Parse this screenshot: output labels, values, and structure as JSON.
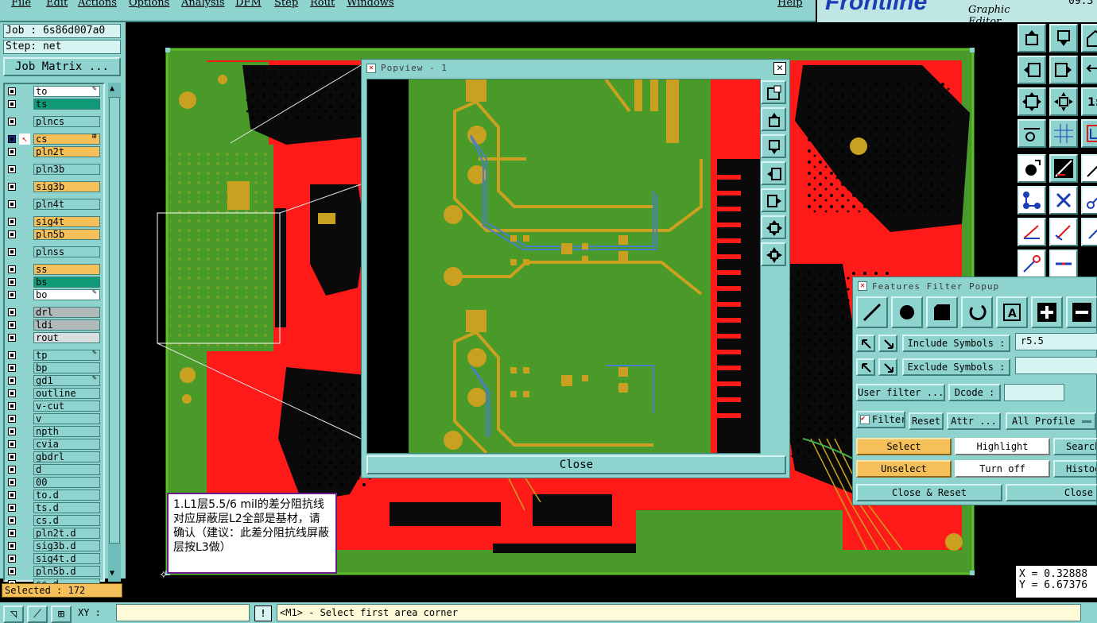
{
  "menubar": {
    "items": [
      "File",
      "Edit",
      "Actions",
      "Options",
      "Analysis",
      "DFM",
      "Step",
      "Rout",
      "Windows"
    ],
    "help": "Help"
  },
  "logo": {
    "brand": "Frontline",
    "subtitle": "Graphic Editor",
    "version": "09.3"
  },
  "job": {
    "label": "Job : 6s86d007a0",
    "step": "Step: net",
    "matrix_button": "Job Matrix ..."
  },
  "layers": [
    {
      "name": "to",
      "color": "#ffffff",
      "tag": "✎"
    },
    {
      "name": "ts",
      "color": "#0f9a78",
      "tag": ""
    },
    {
      "name": "plncs",
      "color": "#8fd3cf",
      "tag": ""
    },
    {
      "name": "cs",
      "color": "#f5c05a",
      "tag": "⊞",
      "active": true
    },
    {
      "name": "pln2t",
      "color": "#f5c05a",
      "tag": ""
    },
    {
      "name": "pln3b",
      "color": "#8fd3cf",
      "tag": ""
    },
    {
      "name": "sig3b",
      "color": "#f5c05a",
      "tag": ""
    },
    {
      "name": "pln4t",
      "color": "#8fd3cf",
      "tag": ""
    },
    {
      "name": "sig4t",
      "color": "#f5c05a",
      "tag": ""
    },
    {
      "name": "pln5b",
      "color": "#f5c05a",
      "tag": ""
    },
    {
      "name": "plnss",
      "color": "#8fd3cf",
      "tag": ""
    },
    {
      "name": "ss",
      "color": "#f5c05a",
      "tag": ""
    },
    {
      "name": "bs",
      "color": "#0f9a78",
      "tag": ""
    },
    {
      "name": "bo",
      "color": "#ffffff",
      "tag": "✎"
    },
    {
      "name": "drl",
      "color": "#aeb9b8",
      "tag": ""
    },
    {
      "name": "ldi",
      "color": "#aeb9b8",
      "tag": ""
    },
    {
      "name": "rout",
      "color": "#d9dede",
      "tag": ""
    },
    {
      "name": "tp",
      "color": "#8fd3cf",
      "tag": "✎"
    },
    {
      "name": "bp",
      "color": "#8fd3cf",
      "tag": ""
    },
    {
      "name": "gd1",
      "color": "#8fd3cf",
      "tag": "✎"
    },
    {
      "name": "outline",
      "color": "#8fd3cf",
      "tag": ""
    },
    {
      "name": "v-cut",
      "color": "#8fd3cf",
      "tag": ""
    },
    {
      "name": "v",
      "color": "#8fd3cf",
      "tag": ""
    },
    {
      "name": "npth",
      "color": "#8fd3cf",
      "tag": ""
    },
    {
      "name": "cvia",
      "color": "#8fd3cf",
      "tag": ""
    },
    {
      "name": "gbdrl",
      "color": "#8fd3cf",
      "tag": ""
    },
    {
      "name": "d",
      "color": "#8fd3cf",
      "tag": ""
    },
    {
      "name": "00",
      "color": "#8fd3cf",
      "tag": ""
    },
    {
      "name": "to.d",
      "color": "#8fd3cf",
      "tag": ""
    },
    {
      "name": "ts.d",
      "color": "#8fd3cf",
      "tag": ""
    },
    {
      "name": "cs.d",
      "color": "#8fd3cf",
      "tag": ""
    },
    {
      "name": "pln2t.d",
      "color": "#8fd3cf",
      "tag": ""
    },
    {
      "name": "sig3b.d",
      "color": "#8fd3cf",
      "tag": ""
    },
    {
      "name": "sig4t.d",
      "color": "#8fd3cf",
      "tag": ""
    },
    {
      "name": "pln5b.d",
      "color": "#8fd3cf",
      "tag": ""
    },
    {
      "name": "ss.d",
      "color": "#8fd3cf",
      "tag": ""
    }
  ],
  "status": {
    "selected": "Selected : 172"
  },
  "bottombar": {
    "xy_label": "XY :",
    "xy_value": "",
    "prompt": "<M1> - Select first area corner",
    "bang": "!"
  },
  "coords": {
    "x": "X = 0.32888",
    "y": "Y = 6.67376"
  },
  "popview": {
    "title": "Popview - 1",
    "close_label": "Close"
  },
  "filter": {
    "title": "Features Filter Popup",
    "include_label": "Include Symbols :",
    "include_value": "r5.5",
    "exclude_label": "Exclude Symbols :",
    "exclude_value": "",
    "user_filter": "User filter ...",
    "dcode_label": "Dcode :",
    "dcode_value": "",
    "filter_label": "Filter",
    "reset_label": "Reset",
    "attr_label": "Attr ...",
    "profile_label": "All Profile",
    "select": "Select",
    "highlight": "Highlight",
    "search": "Search",
    "unselect": "Unselect",
    "turn_off": "Turn off",
    "histogram": "Histogram",
    "close_reset": "Close & Reset",
    "close": "Close"
  },
  "note": {
    "text": "1.L1层5.5/6 mil的差分阻抗线对应屏蔽层L2全部是基材，请确认（建议：此差分阻抗线屏蔽层按L3做）"
  },
  "colors": {
    "board_red": "#ff1a1a",
    "board_green": "#4a9a2a",
    "trace_gold": "#c9a020",
    "panel": "#8fd3cf",
    "accent_yellow": "#f5c05a"
  }
}
